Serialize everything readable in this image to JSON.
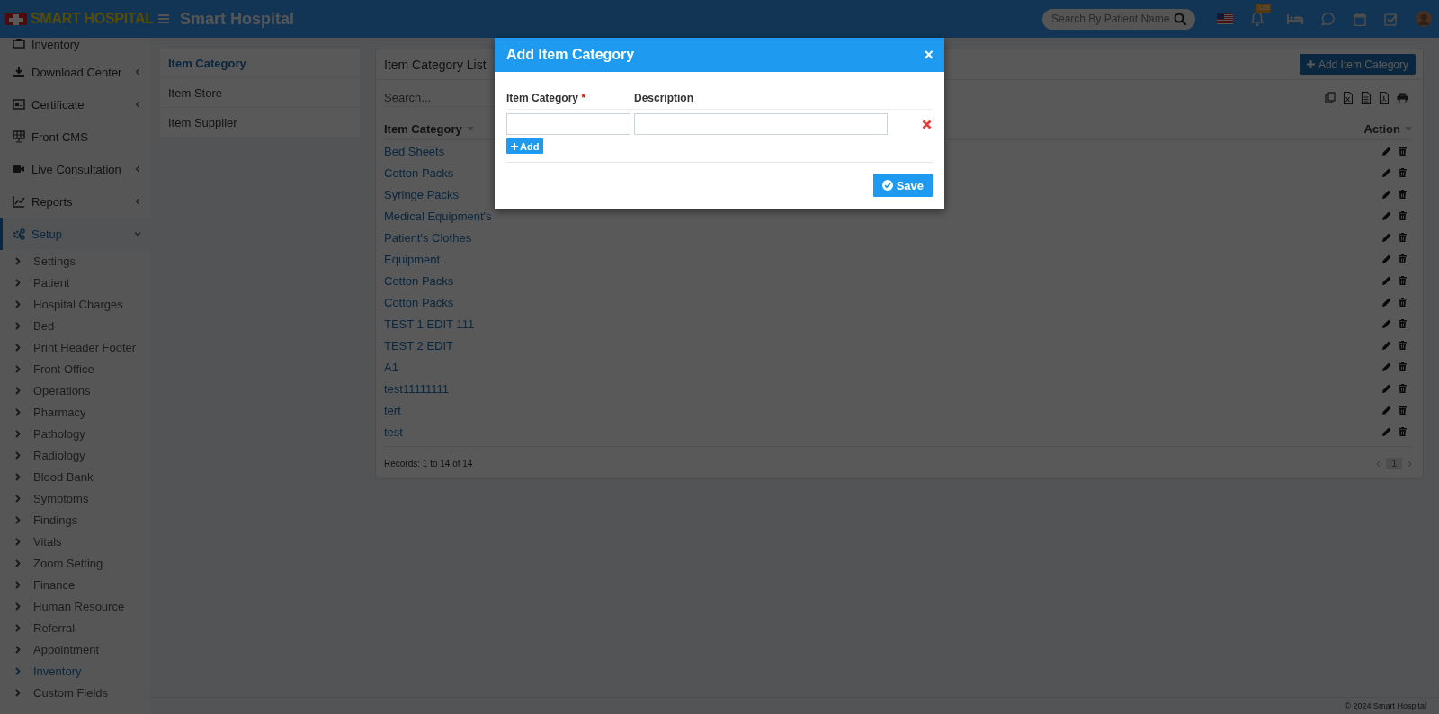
{
  "header": {
    "logo": "SMART HOSPITAL",
    "title": "Smart Hospital",
    "search": {
      "placeholder": "Search By Patient Name"
    },
    "notification_count": "328"
  },
  "sidebar": {
    "items": [
      {
        "label": "Inventory",
        "selected": false
      },
      {
        "label": "Download Center",
        "selected": false,
        "expanded": false
      },
      {
        "label": "Certificate",
        "selected": false,
        "expanded": false
      },
      {
        "label": "Front CMS",
        "selected": false
      },
      {
        "label": "Live Consultation",
        "selected": false,
        "expanded": false
      },
      {
        "label": "Reports",
        "selected": false,
        "expanded": false
      },
      {
        "label": "Setup",
        "selected": true,
        "expanded": true,
        "children": [
          {
            "label": "Settings",
            "selected": false
          },
          {
            "label": "Patient",
            "selected": false
          },
          {
            "label": "Hospital Charges",
            "selected": false
          },
          {
            "label": "Bed",
            "selected": false
          },
          {
            "label": "Print Header Footer",
            "selected": false
          },
          {
            "label": "Front Office",
            "selected": false
          },
          {
            "label": "Operations",
            "selected": false
          },
          {
            "label": "Pharmacy",
            "selected": false
          },
          {
            "label": "Pathology",
            "selected": false
          },
          {
            "label": "Radiology",
            "selected": false
          },
          {
            "label": "Blood Bank",
            "selected": false
          },
          {
            "label": "Symptoms",
            "selected": false
          },
          {
            "label": "Findings",
            "selected": false
          },
          {
            "label": "Vitals",
            "selected": false
          },
          {
            "label": "Zoom Setting",
            "selected": false
          },
          {
            "label": "Finance",
            "selected": false
          },
          {
            "label": "Human Resource",
            "selected": false
          },
          {
            "label": "Referral",
            "selected": false
          },
          {
            "label": "Appointment",
            "selected": false
          },
          {
            "label": "Inventory",
            "selected": true
          },
          {
            "label": "Custom Fields",
            "selected": false
          }
        ]
      }
    ]
  },
  "subnav": {
    "items": [
      {
        "label": "Item Category",
        "selected": true
      },
      {
        "label": "Item Store",
        "selected": false
      },
      {
        "label": "Item Supplier",
        "selected": false
      }
    ]
  },
  "panel": {
    "title": "Item Category List",
    "add_button": "Add Item Category",
    "search": {
      "placeholder": "Search..."
    },
    "table": {
      "columns": [
        "Item Category",
        "Action"
      ],
      "rows": [
        {
          "name": "Bed Sheets"
        },
        {
          "name": "Cotton Packs"
        },
        {
          "name": "Syringe Packs"
        },
        {
          "name": "Medical Equipment's"
        },
        {
          "name": "Patient's Clothes"
        },
        {
          "name": "Equipment.."
        },
        {
          "name": "Cotton Packs"
        },
        {
          "name": "Cotton Packs"
        },
        {
          "name": "TEST 1 EDIT 111"
        },
        {
          "name": "TEST 2 EDIT"
        },
        {
          "name": "A1"
        },
        {
          "name": "test11111111"
        },
        {
          "name": "tert"
        },
        {
          "name": "test"
        }
      ]
    },
    "records": "Records: 1 to 14 of 14",
    "pages": [
      {
        "label": "1",
        "selected": true
      }
    ]
  },
  "footer": "© 2024 Smart Hospital",
  "modal": {
    "title": "Add Item Category",
    "close": "×",
    "required_mark": "*",
    "fields": [
      {
        "label": "Item Category",
        "required": true
      },
      {
        "label": "Description",
        "required": false
      }
    ],
    "add_button": "Add",
    "save_button": "Save"
  }
}
